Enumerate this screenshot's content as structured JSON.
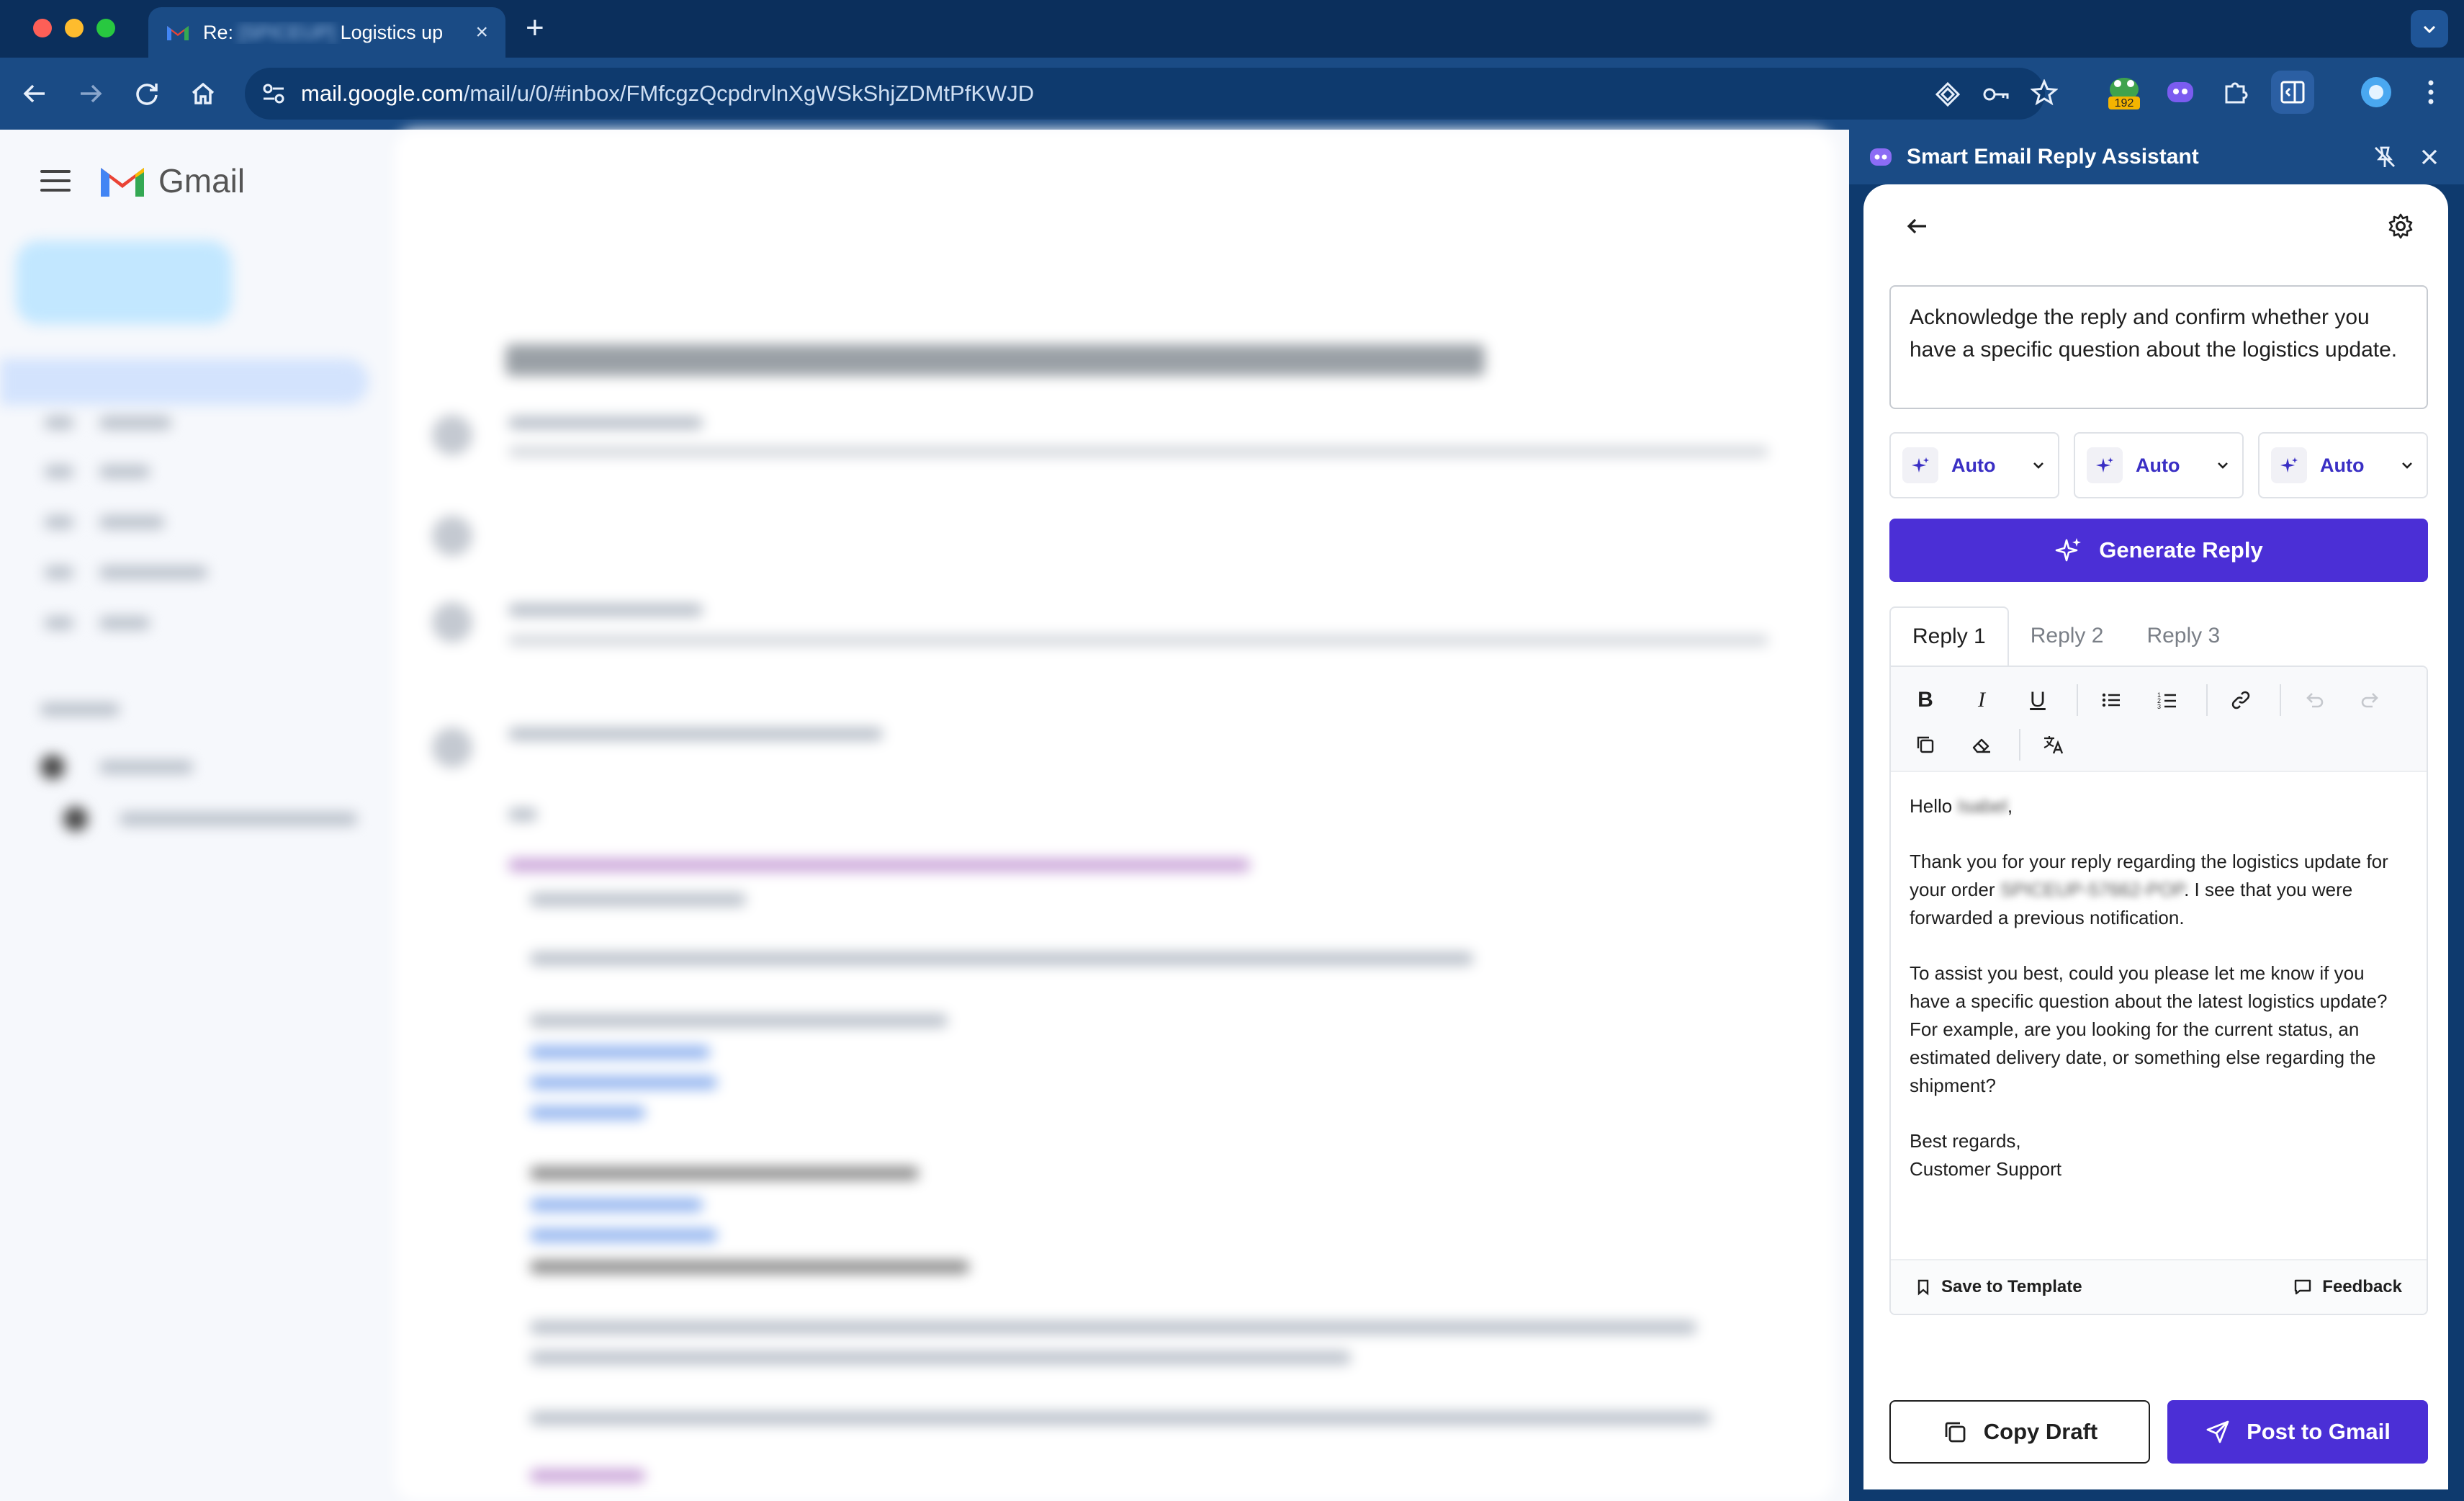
{
  "browser": {
    "tab_prefix": "Re: ",
    "tab_blurred": "[SPICEUP]",
    "tab_title_rest": " Logistics up",
    "close_glyph": "×",
    "new_tab_glyph": "+",
    "url_host": "mail.google.com",
    "url_path": "/mail/u/0/#inbox/FMfcgzQcpdrvlnXgWSkShjZDMtPfKWJD",
    "extension_badge": "192"
  },
  "gmail": {
    "logo_text": "Gmail"
  },
  "panel": {
    "title": "Smart Email Reply Assistant",
    "prompt": "Acknowledge the reply and confirm whether you have a specific question about the logistics update.",
    "selectors": [
      {
        "label": "Auto"
      },
      {
        "label": "Auto"
      },
      {
        "label": "Auto"
      }
    ],
    "generate_label": "Generate Reply",
    "tabs": [
      {
        "label": "Reply 1",
        "active": true
      },
      {
        "label": "Reply 2",
        "active": false
      },
      {
        "label": "Reply 3",
        "active": false
      }
    ],
    "reply": {
      "greeting": "Hello ",
      "greeting_name": "Isabel",
      "greeting_end": ",",
      "para1_start": "Thank you for your reply regarding the logistics update for your order ",
      "order_blurred": "SPICEUP-57662-POP",
      "para1_end": ". I see that you were forwarded a previous notification.",
      "para2": "To assist you best, could you please let me know if you have a specific question about the latest logistics update? For example, are you looking for the current status, an estimated delivery date, or something else regarding the shipment?",
      "signoff": "Best regards,",
      "signature": "Customer Support"
    },
    "save_template_label": "Save to Template",
    "feedback_label": "Feedback",
    "copy_label": "Copy Draft",
    "post_label": "Post to Gmail"
  }
}
